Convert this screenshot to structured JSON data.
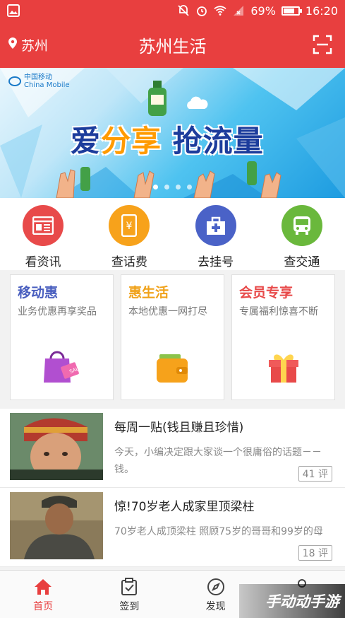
{
  "status_bar": {
    "battery": "69%",
    "battery_level": 0.69,
    "time": "16:20"
  },
  "header": {
    "location": "苏州",
    "title": "苏州生活"
  },
  "banner": {
    "logo_cn": "中国移动",
    "logo_en": "China Mobile",
    "slogan_part1": "爱",
    "slogan_part2": "分享",
    "slogan_part3": "抢流量",
    "slide_count": 4,
    "active_slide": 1
  },
  "services": [
    {
      "label": "看资讯",
      "color": "#e84a4a",
      "icon": "news-icon"
    },
    {
      "label": "查话费",
      "color": "#f7a21b",
      "icon": "phone-bill-icon"
    },
    {
      "label": "去挂号",
      "color": "#4a62c7",
      "icon": "hospital-icon"
    },
    {
      "label": "查交通",
      "color": "#6ab83c",
      "icon": "bus-icon"
    }
  ],
  "cards": [
    {
      "title": "移动惠",
      "desc": "业务优惠再享奖品",
      "color": "#4a5fbf",
      "icon": "shopping-bag-icon"
    },
    {
      "title": "惠生活",
      "desc": "本地优惠一网打尽",
      "color": "#f0a21a",
      "icon": "wallet-icon"
    },
    {
      "title": "会员专享",
      "desc": "专属福利惊喜不断",
      "color": "#e84a4a",
      "icon": "gift-icon"
    }
  ],
  "articles": [
    {
      "title": "每周一贴(钱且赚且珍惜)",
      "desc": "今天，小编决定跟大家谈一个很庸俗的话题－－钱。",
      "count": "41 评"
    },
    {
      "title": "惊!70岁老人成家里顶梁柱",
      "desc": "70岁老人成顶梁柱 照顾75岁的哥哥和99岁的母",
      "count": "18 评"
    }
  ],
  "bottom_nav": [
    {
      "label": "首页",
      "icon": "home-icon",
      "active": true
    },
    {
      "label": "签到",
      "icon": "checkin-icon",
      "active": false
    },
    {
      "label": "发现",
      "icon": "compass-icon",
      "active": false
    },
    {
      "label": "",
      "icon": "profile-icon",
      "active": false
    }
  ],
  "watermark": "手动动手游",
  "colors": {
    "primary": "#e83f3f"
  }
}
